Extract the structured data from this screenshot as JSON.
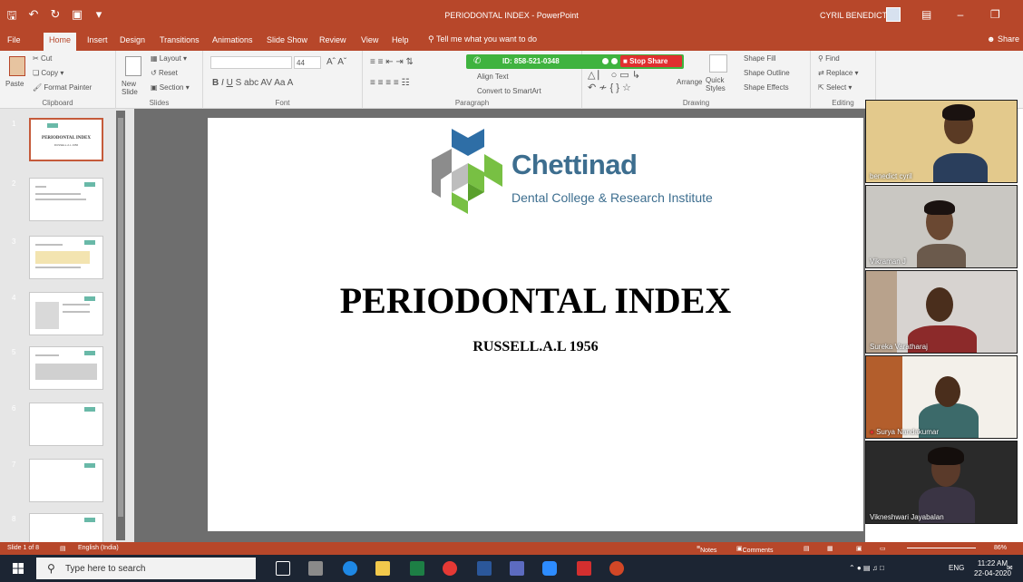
{
  "window": {
    "title": "PERIODONTAL INDEX - PowerPoint",
    "user": "CYRIL BENEDICT"
  },
  "tabs": [
    "File",
    "Home",
    "Insert",
    "Design",
    "Transitions",
    "Animations",
    "Slide Show",
    "Review",
    "View",
    "Help"
  ],
  "tell_me": "Tell me what you want to do",
  "share": "Share",
  "ribbon": {
    "clipboard": {
      "label": "Clipboard",
      "paste": "Paste",
      "cut": "Cut",
      "copy": "Copy",
      "format_painter": "Format Painter"
    },
    "slides": {
      "label": "Slides",
      "new_slide": "New Slide",
      "layout": "Layout",
      "reset": "Reset",
      "section": "Section"
    },
    "font": {
      "label": "Font",
      "size": "44"
    },
    "paragraph": {
      "label": "Paragraph",
      "align_text": "Align Text",
      "convert_smartart": "Convert to SmartArt"
    },
    "drawing": {
      "label": "Drawing",
      "arrange": "Arrange",
      "quick_styles": "Quick Styles",
      "shape_fill": "Shape Fill",
      "shape_outline": "Shape Outline",
      "shape_effects": "Shape Effects"
    },
    "editing": {
      "label": "Editing",
      "find": "Find",
      "replace": "Replace",
      "select": "Select"
    }
  },
  "zoom_meeting": {
    "meeting_id": "ID: 858-521-0348",
    "stop_share": "Stop Share"
  },
  "thumbnails": {
    "numbers": [
      "1",
      "2",
      "3",
      "4",
      "5",
      "6",
      "7",
      "8"
    ],
    "slide1_title": "PERIODONTAL INDEX",
    "slide1_sub": "RUSSELL.A.L 1956"
  },
  "slide": {
    "logo_name": "Chettinad",
    "logo_sub": "Dental College & Research Institute",
    "title": "PERIODONTAL INDEX",
    "subtitle": "RUSSELL.A.L 1956"
  },
  "participants": [
    {
      "name": "benedict cyril"
    },
    {
      "name": "Vikraman J"
    },
    {
      "name": "Sureka Varatharaj"
    },
    {
      "name": "Surya Nandakumar"
    },
    {
      "name": "Vikneshwari Jayabalan"
    }
  ],
  "statusbar": {
    "slide_info": "Slide 1 of 8",
    "language": "English (India)",
    "notes": "Notes",
    "comments": "Comments",
    "zoom": "86%"
  },
  "taskbar": {
    "search_placeholder": "Type here to search",
    "lang": "ENG",
    "time": "11:22 AM",
    "date": "22-04-2020"
  },
  "colors": {
    "accent": "#b7472a",
    "zoom_green": "#3fb33f",
    "stop_red": "#e02f2f",
    "logo_blue": "#3d6e8f",
    "logo_green": "#78c043"
  }
}
